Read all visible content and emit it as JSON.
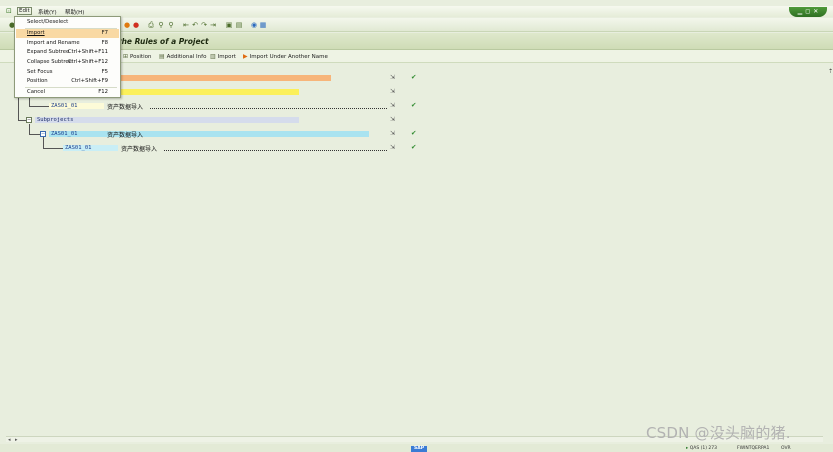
{
  "menubar": {
    "items": [
      "Edit",
      "系统(Y)",
      "帮助(H)"
    ]
  },
  "page": {
    "title": "the Rules of a Project"
  },
  "app_toolbar": {
    "position_label": "Position",
    "additional_info_label": "Additional Info",
    "import_label": "Import",
    "import_under_another_name_label": "Import Under Another Name"
  },
  "edit_menu": {
    "items": [
      {
        "label": "Select/Deselect",
        "shortcut": ""
      },
      {
        "label": "Import",
        "shortcut": "F7"
      },
      {
        "label": "Import and Rename",
        "shortcut": "F8"
      },
      {
        "label": "Expand Subtree",
        "shortcut": "Ctrl+Shift+F11"
      },
      {
        "label": "Collapse Subtree",
        "shortcut": "Ctrl+Shift+F12"
      },
      {
        "label": "Set Focus",
        "shortcut": "F5"
      },
      {
        "label": "Position",
        "shortcut": "Ctrl+Shift+F9"
      },
      {
        "label": "Cancel",
        "shortcut": "F12"
      }
    ],
    "highlighted": "Import"
  },
  "tree": {
    "rows": [
      {
        "label": "",
        "desc": "",
        "color": "#f7b57a"
      },
      {
        "label": "",
        "desc": "",
        "color": "#fbf05a"
      },
      {
        "label": "ZAS01_01",
        "desc": "资产数据导入",
        "color": "#fdfbd8"
      },
      {
        "label": "Subprojects",
        "desc": "",
        "color": "#d5dcec"
      },
      {
        "label": "ZAS01_01",
        "desc": "资产数据导入",
        "color": "#a9e3f0"
      },
      {
        "label": "ZAS01_01",
        "desc": "资产数据导入",
        "color": "#c9eef6"
      }
    ]
  },
  "status_bar": {
    "sap_logo": "SAP",
    "system_info": "QAS (1) 273",
    "server": "FWINTQERPA1",
    "mode": "OVR"
  },
  "watermark": "CSDN @没头脑的猪."
}
